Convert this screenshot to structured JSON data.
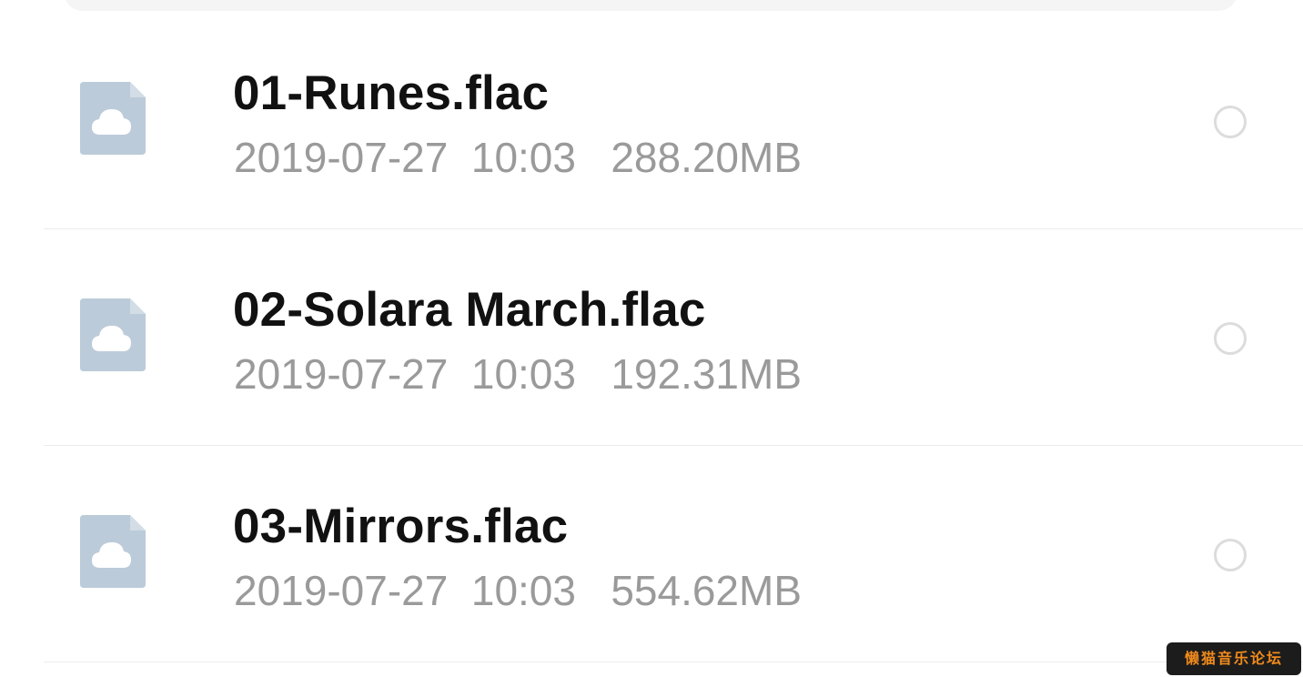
{
  "files": [
    {
      "name": "01-Runes.flac",
      "meta": "2019-07-27  10:03   288.20MB"
    },
    {
      "name": "02-Solara March.flac",
      "meta": "2019-07-27  10:03   192.31MB"
    },
    {
      "name": "03-Mirrors.flac",
      "meta": "2019-07-27  10:03   554.62MB"
    }
  ],
  "watermark": {
    "text": "懒猫音乐论坛"
  },
  "icons": {
    "file": "cloud-file-icon",
    "select": "radio-unchecked-icon"
  },
  "colors": {
    "file_icon": "#bccbd9",
    "file_icon_fold": "#d3dde6",
    "meta_text": "#9a9a9a",
    "name_text": "#111111",
    "radio_border": "#dcdcdc",
    "watermark_text": "#f08a1c",
    "watermark_bg": "#1c1c1c"
  }
}
